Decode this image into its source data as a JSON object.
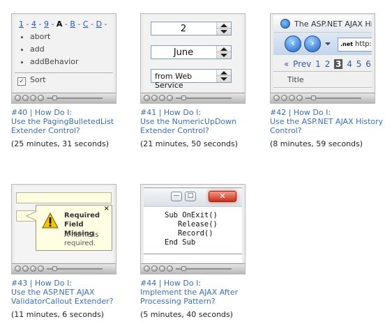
{
  "videos": [
    {
      "caption_line1": "#40 | How Do I:",
      "caption_line2": "Use the PagingBulletedList Extender Control?",
      "duration": "(25 minutes, 31 seconds)",
      "thumb": {
        "letters": [
          "1",
          "4",
          "9",
          "A",
          "B",
          "C",
          "D"
        ],
        "current_letter": "A",
        "items": [
          "abort",
          "add",
          "addBehavior"
        ],
        "sort_label": "Sort",
        "sort_checked": true
      }
    },
    {
      "caption_line1": "#41 | How Do I:",
      "caption_line2": "Use the NumericUpDown Extender Control?",
      "duration": "(21 minutes, 50 seconds)",
      "thumb": {
        "spinners": [
          "2",
          "June",
          "from Web Service"
        ]
      }
    },
    {
      "caption_line1": "#42 | How Do I:",
      "caption_line2": "Use the ASP.NET AJAX History Control?",
      "duration": "(8 minutes, 59 seconds)",
      "thumb": {
        "window_title": "The ASP.NET AJAX His",
        "address_prefix": ".net",
        "address": "http:/",
        "pager_prev": "« Prev",
        "pager_pages": [
          "1",
          "2",
          "3",
          "4",
          "5",
          "6"
        ],
        "pager_current": "3",
        "column_title": "Title"
      }
    },
    {
      "caption_line1": "#43 | How Do I:",
      "caption_line2": "Use the ASP.NET AJAX ValidatorCallout Extender?",
      "duration": "(11 minutes, 6 seconds)",
      "thumb": {
        "callout_title_line1": "Required",
        "callout_title_line2": "Field Missing",
        "callout_msg_line1": "A name is",
        "callout_msg_line2": "required.",
        "close_glyph": "×"
      }
    },
    {
      "caption_line1": "#44 | How Do I:",
      "caption_line2": "Implement the AJAX After Processing Pattern?",
      "duration": "(5 minutes, 40 seconds)",
      "thumb": {
        "code": "Sub OnExit()\n   Release()\n   Record()\nEnd Sub"
      }
    }
  ],
  "colors": {
    "link": "#3a6fb5",
    "text": "#222222"
  }
}
